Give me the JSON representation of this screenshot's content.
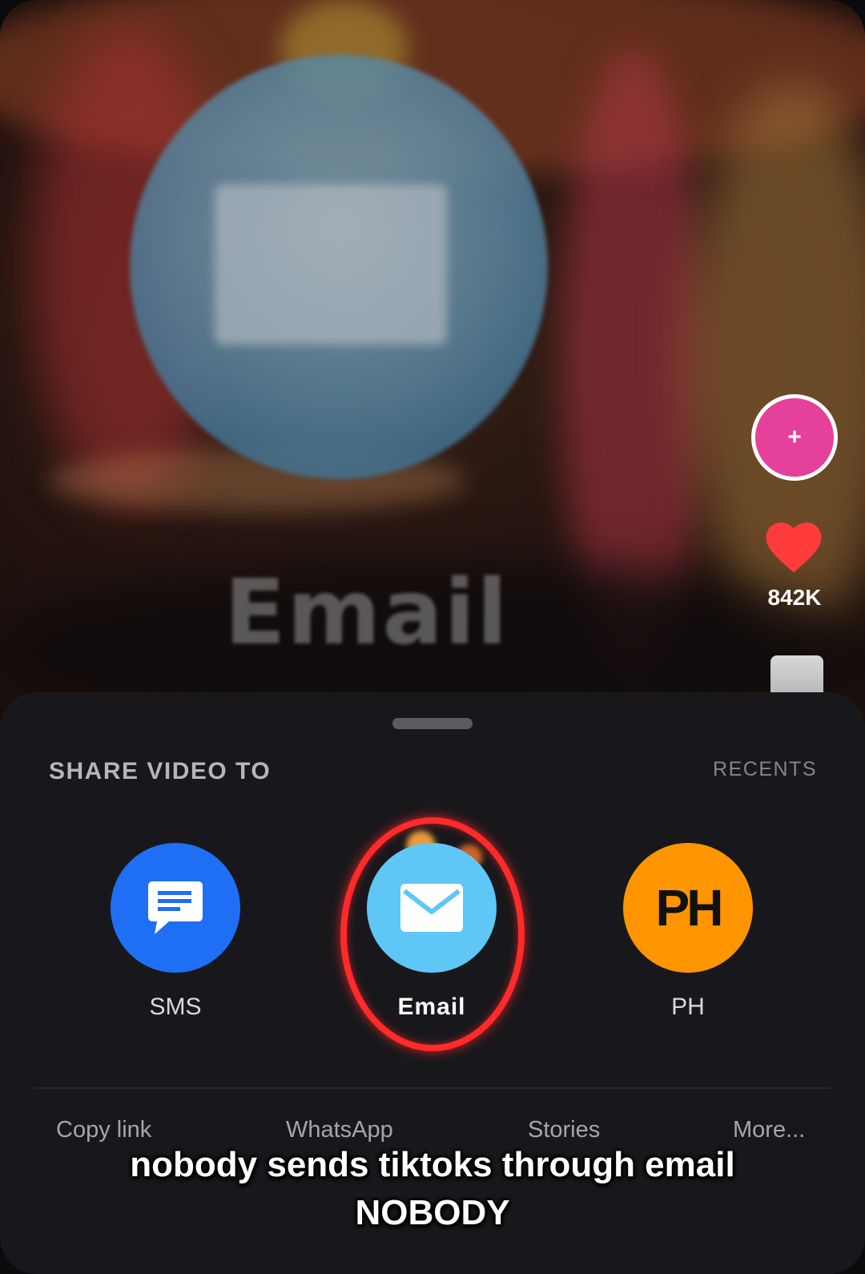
{
  "video": {
    "overlay_text": "Email",
    "like_count": "842K",
    "follow_symbol": "+"
  },
  "share_sheet": {
    "title": "SHARE VIDEO TO",
    "recents_label": "RECENTS",
    "targets": [
      {
        "label": "SMS",
        "icon": "message-bubble-icon",
        "color": "#1f6ff5"
      },
      {
        "label": "Email",
        "icon": "envelope-icon",
        "color": "#5ec7f6",
        "highlighted": true
      },
      {
        "label": "PH",
        "initials": "PH",
        "color": "#ff9500"
      }
    ],
    "actions": [
      "Copy link",
      "WhatsApp",
      "Stories",
      "More..."
    ]
  },
  "caption": {
    "line1": "nobody sends tiktoks through email",
    "line2": "NOBODY"
  },
  "colors": {
    "highlight_ring": "#ff2a2a",
    "sheet_bg": "#18181c",
    "follow_button": "#e5409a",
    "like_heart": "#ff3b3b"
  }
}
